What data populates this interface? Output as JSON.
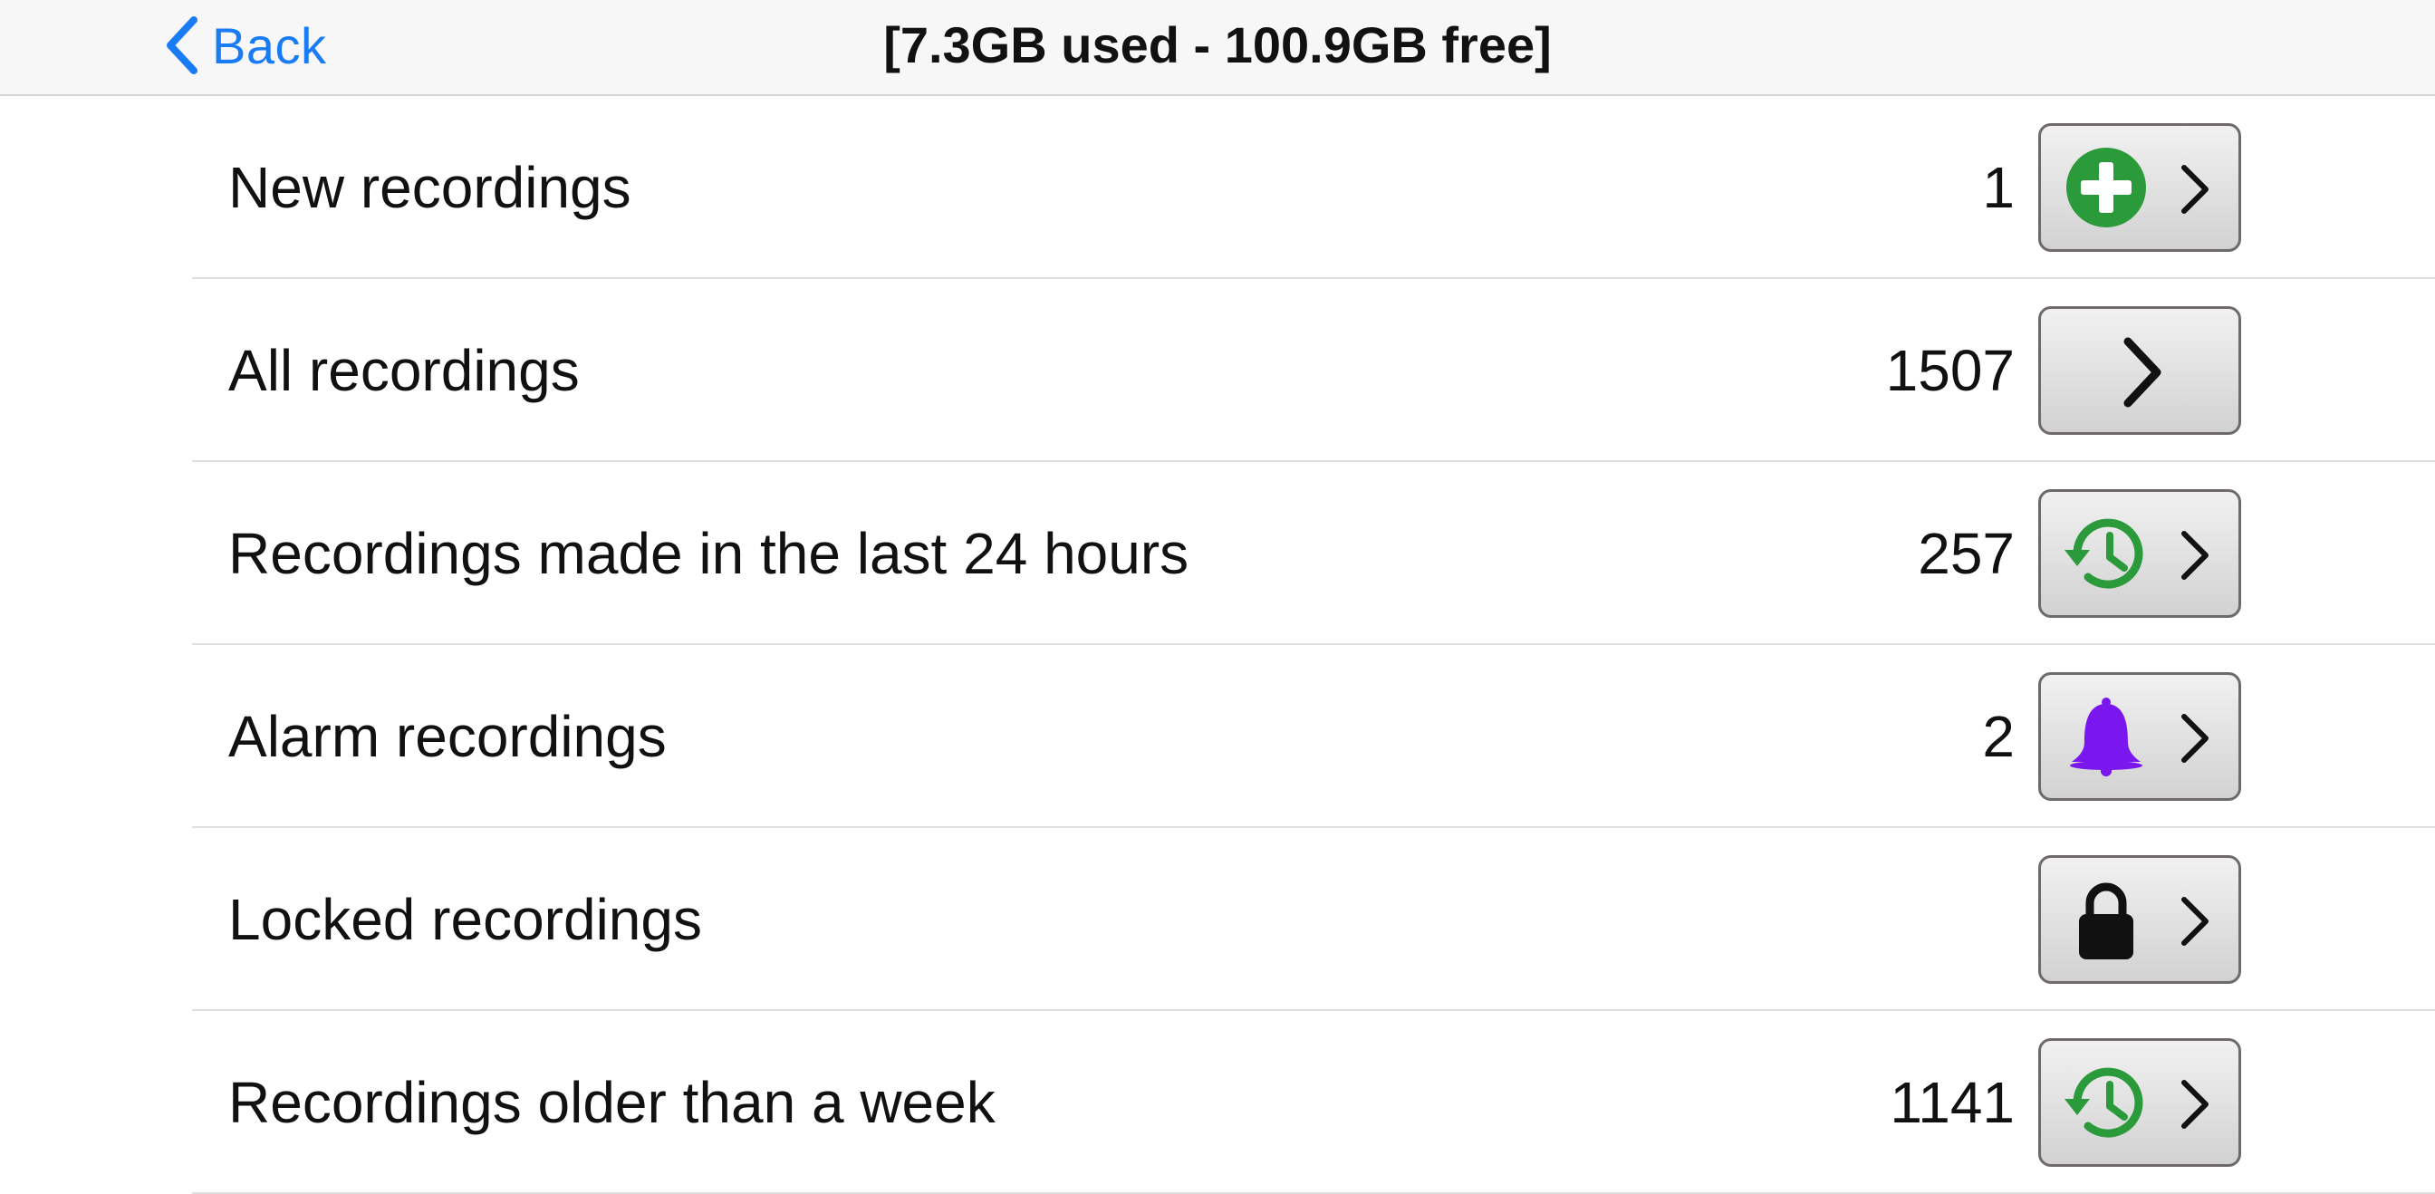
{
  "navbar": {
    "back_label": "Back",
    "title": "[7.3GB used - 100.9GB free]",
    "accent_color": "#1a7cf5"
  },
  "rows": [
    {
      "label": "New recordings",
      "count": "1",
      "icon": "plus-circle-icon",
      "icon_color": "#2a9a3a"
    },
    {
      "label": "All recordings",
      "count": "1507",
      "icon": "chevron-right-icon",
      "icon_color": "#111111"
    },
    {
      "label": "Recordings made in the last 24 hours",
      "count": "257",
      "icon": "history-clock-icon",
      "icon_color": "#2a9a3a"
    },
    {
      "label": "Alarm recordings",
      "count": "2",
      "icon": "bell-icon",
      "icon_color": "#7a16ee"
    },
    {
      "label": "Locked recordings",
      "count": "",
      "icon": "lock-icon",
      "icon_color": "#111111"
    },
    {
      "label": "Recordings older than a week",
      "count": "1141",
      "icon": "history-clock-icon",
      "icon_color": "#2a9a3a"
    }
  ]
}
